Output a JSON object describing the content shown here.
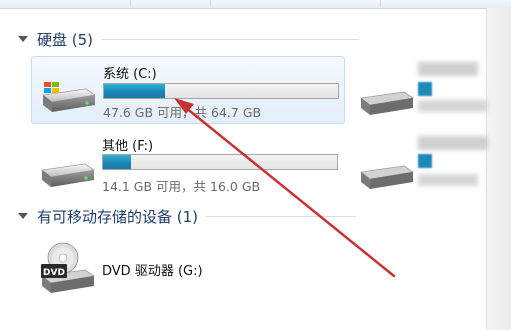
{
  "window": {
    "toolbar_items": [
      "",
      "",
      ""
    ]
  },
  "groups": [
    {
      "title": "硬盘 (5)",
      "drives": [
        {
          "name": "系统 (C:)",
          "usage_fraction": 0.26,
          "info": "47.6 GB 可用，共 64.7 GB",
          "selected": true,
          "icon": "hard-drive-windows-icon"
        },
        {
          "name": "其他 (F:)",
          "usage_fraction": 0.12,
          "info": "14.1 GB 可用，共 16.0 GB",
          "selected": false,
          "icon": "hard-drive-icon"
        }
      ]
    },
    {
      "title": "有可移动存储的设备 (1)",
      "drives": [
        {
          "name": "DVD 驱动器 (G:)",
          "icon": "dvd-drive-icon"
        }
      ]
    }
  ],
  "annotation": {
    "color": "#c83232",
    "icon": "red-arrow"
  },
  "colors": {
    "bar_fill": "#1a86b4",
    "group_title": "#1e3d6b",
    "selected_bg": "#e3eef9"
  }
}
